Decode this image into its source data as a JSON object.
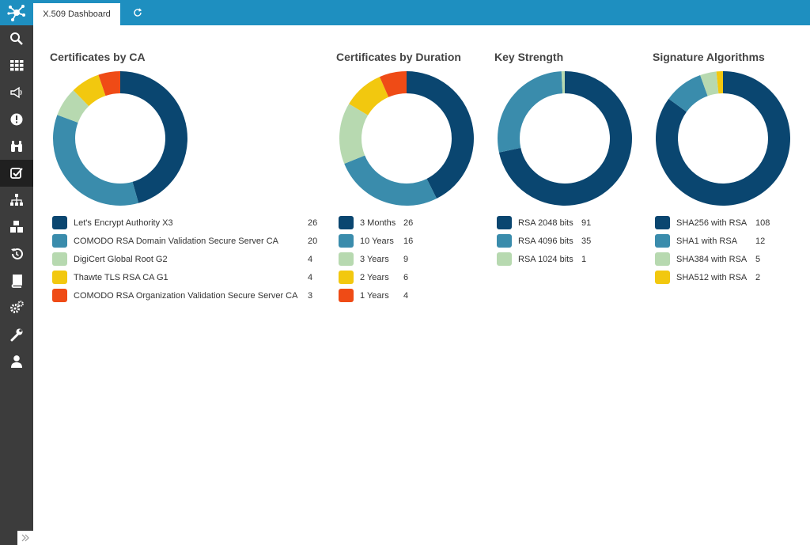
{
  "app": {
    "tab_label": "X.509 Dashboard"
  },
  "sidebar": {
    "items": [
      {
        "name": "search-icon"
      },
      {
        "name": "grid-icon"
      },
      {
        "name": "megaphone-icon"
      },
      {
        "name": "alert-icon"
      },
      {
        "name": "binoculars-icon"
      },
      {
        "name": "checkbox-icon",
        "active": true
      },
      {
        "name": "sitemap-icon"
      },
      {
        "name": "cubes-icon"
      },
      {
        "name": "history-icon"
      },
      {
        "name": "book-icon"
      },
      {
        "name": "cogs-icon"
      },
      {
        "name": "wrench-icon"
      },
      {
        "name": "user-icon"
      }
    ]
  },
  "colors": [
    "#0a4670",
    "#3a8cac",
    "#b7d9b0",
    "#f2c80f",
    "#ef4b16"
  ],
  "panels": [
    {
      "id": "ca",
      "title": "Certificates by CA",
      "legend": [
        {
          "label": "Let's Encrypt Authority X3",
          "count": "26"
        },
        {
          "label": "COMODO RSA Domain Validation Secure Server CA",
          "count": "20"
        },
        {
          "label": "DigiCert Global Root G2",
          "count": "4"
        },
        {
          "label": "Thawte TLS RSA CA G1",
          "count": "4"
        },
        {
          "label": "COMODO RSA Organization Validation Secure Server CA",
          "count": "3"
        }
      ]
    },
    {
      "id": "duration",
      "title": "Certificates by Duration",
      "legend": [
        {
          "label": "3 Months",
          "count": "26"
        },
        {
          "label": "10 Years",
          "count": "16"
        },
        {
          "label": "3 Years",
          "count": "9"
        },
        {
          "label": "2 Years",
          "count": "6"
        },
        {
          "label": "1 Years",
          "count": "4"
        }
      ]
    },
    {
      "id": "key",
      "title": "Key Strength",
      "legend": [
        {
          "label": "RSA 2048 bits",
          "count": "91"
        },
        {
          "label": "RSA 4096 bits",
          "count": "35"
        },
        {
          "label": "RSA 1024 bits",
          "count": "1"
        }
      ]
    },
    {
      "id": "sig",
      "title": "Signature Algorithms",
      "legend": [
        {
          "label": "SHA256 with RSA",
          "count": "108"
        },
        {
          "label": "SHA1 with RSA",
          "count": "12"
        },
        {
          "label": "SHA384 with RSA",
          "count": "5"
        },
        {
          "label": "SHA512 with RSA",
          "count": "2"
        }
      ]
    }
  ],
  "chart_data": [
    {
      "type": "pie",
      "title": "Certificates by CA",
      "categories": [
        "Let's Encrypt Authority X3",
        "COMODO RSA Domain Validation Secure Server CA",
        "DigiCert Global Root G2",
        "Thawte TLS RSA CA G1",
        "COMODO RSA Organization Validation Secure Server CA"
      ],
      "values": [
        26,
        20,
        4,
        4,
        3
      ]
    },
    {
      "type": "pie",
      "title": "Certificates by Duration",
      "categories": [
        "3 Months",
        "10 Years",
        "3 Years",
        "2 Years",
        "1 Years"
      ],
      "values": [
        26,
        16,
        9,
        6,
        4
      ]
    },
    {
      "type": "pie",
      "title": "Key Strength",
      "categories": [
        "RSA 2048 bits",
        "RSA 4096 bits",
        "RSA 1024 bits"
      ],
      "values": [
        91,
        35,
        1
      ]
    },
    {
      "type": "pie",
      "title": "Signature Algorithms",
      "categories": [
        "SHA256 with RSA",
        "SHA1 with RSA",
        "SHA384 with RSA",
        "SHA512 with RSA"
      ],
      "values": [
        108,
        12,
        5,
        2
      ]
    }
  ]
}
